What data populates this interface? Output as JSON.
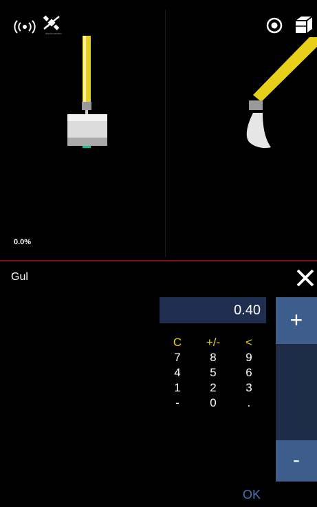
{
  "view": {
    "satellite_caption": "disconnected",
    "grade_percent": "0.0%",
    "colors": {
      "arm": "#e8d01a",
      "bucket": "#dcdcdc",
      "divider": "#7a1010"
    }
  },
  "icons": {
    "signal": "signal-broadcast-icon",
    "satellite": "satellite-off-icon",
    "target": "target-icon",
    "view3d": "cube-view-icon",
    "close": "close-icon"
  },
  "editor": {
    "field_name": "Gul",
    "value": "0.40",
    "keys": [
      [
        "C",
        "+/-",
        "<"
      ],
      [
        "7",
        "8",
        "9"
      ],
      [
        "4",
        "5",
        "6"
      ],
      [
        "1",
        "2",
        "3"
      ],
      [
        "-",
        "0",
        "."
      ]
    ],
    "plus_label": "+",
    "minus_label": "-",
    "ok_label": "OK",
    "colors": {
      "value_box": "#1f2d4e",
      "stepper": "#3d5e8c",
      "accent_keys": "#e4d21c",
      "ok": "#4a73b5"
    }
  }
}
